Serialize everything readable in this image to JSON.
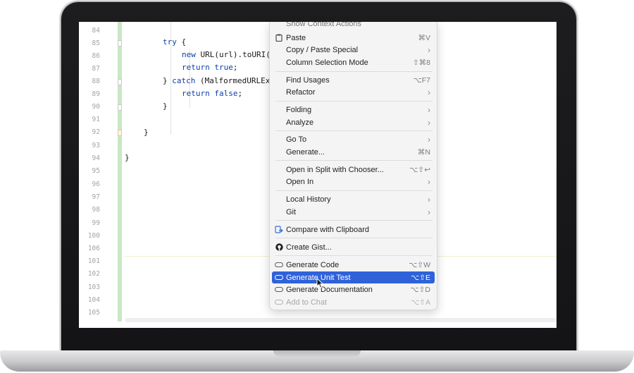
{
  "editor": {
    "line_numbers": [
      "84",
      "85",
      "86",
      "87",
      "88",
      "89",
      "90",
      "91",
      "92",
      "93",
      "94",
      "95",
      "96",
      "97",
      "98",
      "99",
      "100",
      "101",
      "102",
      "103",
      "104",
      "105",
      "106"
    ],
    "code": {
      "l85_kw": "try",
      "l85_rest": " {",
      "l86_kw": "new",
      "l86_rest": " URL(url).toURI(",
      "l87_kw": "return",
      "l87_val": " true",
      "l87_rest": ";",
      "l88_pre": "} ",
      "l88_kw": "catch",
      "l88_rest": " (MalformedURLEx",
      "l89_kw": "return",
      "l89_val": " false",
      "l89_rest": ";",
      "l90": "}",
      "l92": "}",
      "l94": "}"
    }
  },
  "context_menu": {
    "clipped_top": "Show Context Actions",
    "items": [
      {
        "label": "Paste",
        "shortcut": "⌘V",
        "icon": "clipboard-icon"
      },
      {
        "label": "Copy / Paste Special",
        "submenu": "›"
      },
      {
        "label": "Column Selection Mode",
        "shortcut": "⇧⌘8"
      },
      {
        "label": "Find Usages",
        "shortcut": "⌥F7"
      },
      {
        "label": "Refactor",
        "submenu": "›"
      },
      {
        "label": "Folding",
        "submenu": "›"
      },
      {
        "label": "Analyze",
        "submenu": "›"
      },
      {
        "label": "Go To",
        "submenu": "›"
      },
      {
        "label": "Generate...",
        "shortcut": "⌘N"
      },
      {
        "label": "Open in Split with Chooser...",
        "shortcut": "⌥⇧↩"
      },
      {
        "label": "Open In",
        "submenu": "›"
      },
      {
        "label": "Local History",
        "submenu": "›"
      },
      {
        "label": "Git",
        "submenu": "›"
      },
      {
        "label": "Compare with Clipboard",
        "icon": "compare-icon"
      },
      {
        "label": "Create Gist...",
        "icon": "github-icon"
      },
      {
        "label": "Generate Code",
        "shortcut": "⌥⇧W",
        "icon": "ai-pill-icon"
      },
      {
        "label": "Generate Unit Test",
        "shortcut": "⌥⇧E",
        "icon": "ai-pill-icon",
        "selected": true
      },
      {
        "label": "Generate Documentation",
        "shortcut": "⌥⇧D",
        "icon": "ai-pill-icon"
      },
      {
        "label": "Add to Chat",
        "shortcut": "⌥⇧A",
        "icon": "ai-pill-icon",
        "disabled": true
      }
    ]
  },
  "colors": {
    "selection": "#2f62d9",
    "keyword": "#0b3fa8",
    "change_bar": "#c9e7c4"
  }
}
